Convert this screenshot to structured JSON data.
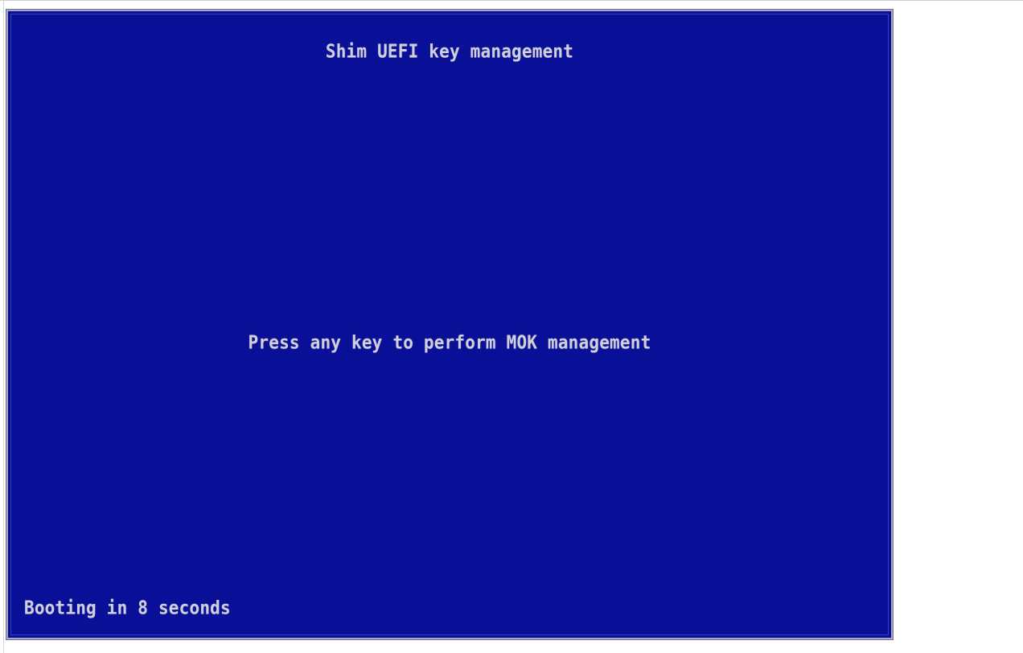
{
  "screen": {
    "title": "Shim UEFI key management",
    "prompt": "Press any key to perform MOK management",
    "countdown": "Booting in 8 seconds"
  },
  "colors": {
    "background": "#0a0f98",
    "text": "#cfd0dc",
    "page": "#ffffff"
  }
}
